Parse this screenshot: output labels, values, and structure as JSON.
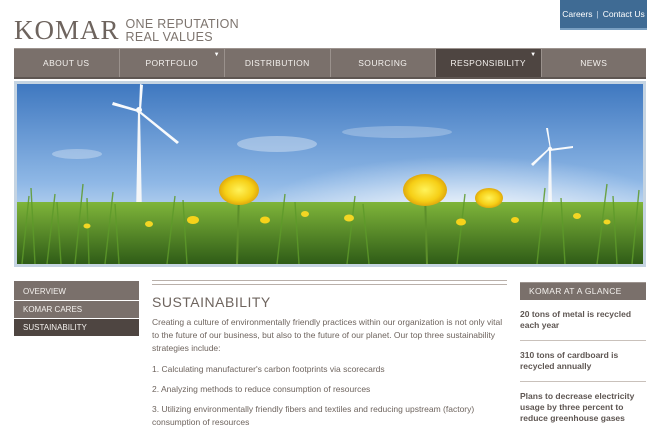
{
  "header": {
    "logo": "KOMAR",
    "tagline_line1": "ONE REPUTATION",
    "tagline_line2": "REAL VALUES",
    "utility": {
      "careers": "Careers",
      "separator": "|",
      "contact": "Contact Us"
    }
  },
  "nav": {
    "items": [
      {
        "label": "ABOUT US",
        "active": false,
        "has_menu": false
      },
      {
        "label": "PORTFOLIO",
        "active": false,
        "has_menu": true
      },
      {
        "label": "DISTRIBUTION",
        "active": false,
        "has_menu": false
      },
      {
        "label": "SOURCING",
        "active": false,
        "has_menu": false
      },
      {
        "label": "RESPONSIBILITY",
        "active": true,
        "has_menu": true
      },
      {
        "label": "NEWS",
        "active": false,
        "has_menu": false
      }
    ]
  },
  "sidebar": {
    "items": [
      {
        "label": "OVERVIEW",
        "active": false
      },
      {
        "label": "KOMAR CARES",
        "active": false
      },
      {
        "label": "SUSTAINABILITY",
        "active": true
      }
    ]
  },
  "main": {
    "title": "SUSTAINABILITY",
    "intro": "Creating a culture of environmentally friendly practices within our organization is not only vital to the future of our business, but also to the future of our planet. Our top three sustainability strategies include:",
    "items": [
      "1.  Calculating manufacturer's carbon footprints via scorecards",
      "2.  Analyzing methods to reduce consumption of resources",
      "3. Utilizing environmentally friendly fibers and textiles and reducing upstream (factory) consumption of resources"
    ]
  },
  "glance": {
    "title": "KOMAR AT A GLANCE",
    "items": [
      "20 tons of metal is recycled each year",
      "310 tons of cardboard is recycled annually",
      "Plans to decrease electricity usage by three percent to reduce greenhouse gases"
    ]
  },
  "colors": {
    "nav": "#7a706b",
    "nav_active": "#4e4541",
    "utility": "#3f6b94",
    "text": "#6e645e"
  },
  "icons": {
    "nav_caret": "caret-down-icon"
  }
}
